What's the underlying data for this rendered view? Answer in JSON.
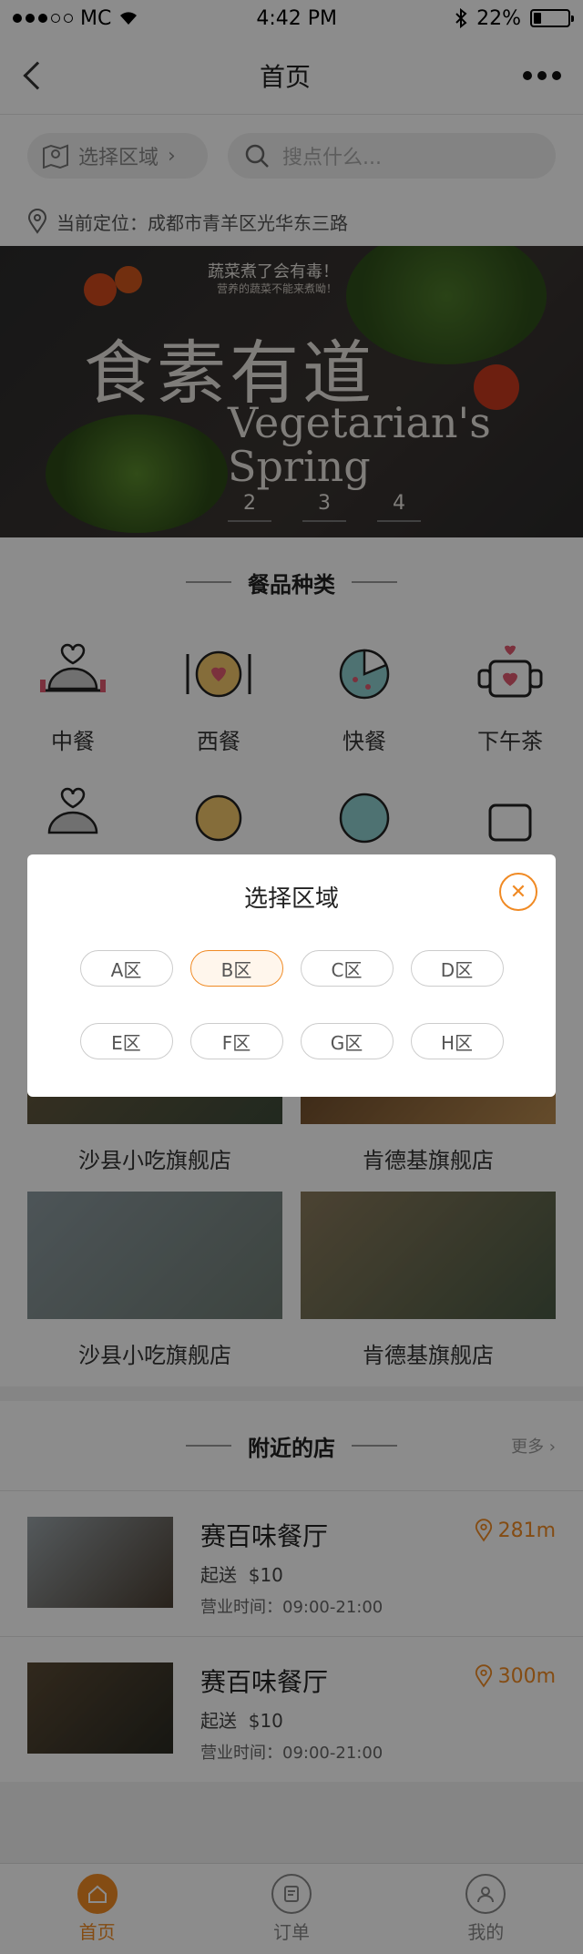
{
  "status": {
    "carrier": "MC",
    "time": "4:42 PM",
    "battery": "22%",
    "battery_level": 0.22
  },
  "nav": {
    "title": "首页"
  },
  "search": {
    "area_label": "选择区域",
    "placeholder": "搜点什么..."
  },
  "location": {
    "text": "当前定位：成都市青羊区光华东三路"
  },
  "banner": {
    "tagline": "蔬菜煮了会有毒！",
    "tagline2": "营养的蔬菜不能来煮呦！",
    "title_cn": "食素有道",
    "title_en": "Vegetarian's Spring",
    "pager": [
      "2",
      "3",
      "4"
    ]
  },
  "categories": {
    "title": "餐品种类",
    "items": [
      {
        "label": "中餐",
        "icon": "cloche-icon"
      },
      {
        "label": "西餐",
        "icon": "plate-icon"
      },
      {
        "label": "快餐",
        "icon": "pizza-icon"
      },
      {
        "label": "下午茶",
        "icon": "teacup-icon"
      }
    ]
  },
  "shops": [
    {
      "name": "沙县小吃旗舰店"
    },
    {
      "name": "肯德基旗舰店"
    },
    {
      "name": "沙县小吃旗舰店"
    },
    {
      "name": "肯德基旗舰店"
    }
  ],
  "nearby": {
    "title": "附近的店",
    "more": "更多",
    "items": [
      {
        "name": "赛百味餐厅",
        "price_label": "起送",
        "price": "$10",
        "hours": "营业时间：09:00-21:00",
        "distance": "281m"
      },
      {
        "name": "赛百味餐厅",
        "price_label": "起送",
        "price": "$10",
        "hours": "营业时间：09:00-21:00",
        "distance": "300m"
      }
    ]
  },
  "tabs": [
    {
      "label": "首页",
      "icon": "home-icon"
    },
    {
      "label": "订单",
      "icon": "order-icon"
    },
    {
      "label": "我的",
      "icon": "user-icon"
    }
  ],
  "modal": {
    "title": "选择区域",
    "options": [
      "A区",
      "B区",
      "C区",
      "D区",
      "E区",
      "F区",
      "G区",
      "H区"
    ],
    "selected": "B区"
  },
  "colors": {
    "accent": "#f08a24",
    "overlay": "rgba(0,0,0,0.45)"
  }
}
